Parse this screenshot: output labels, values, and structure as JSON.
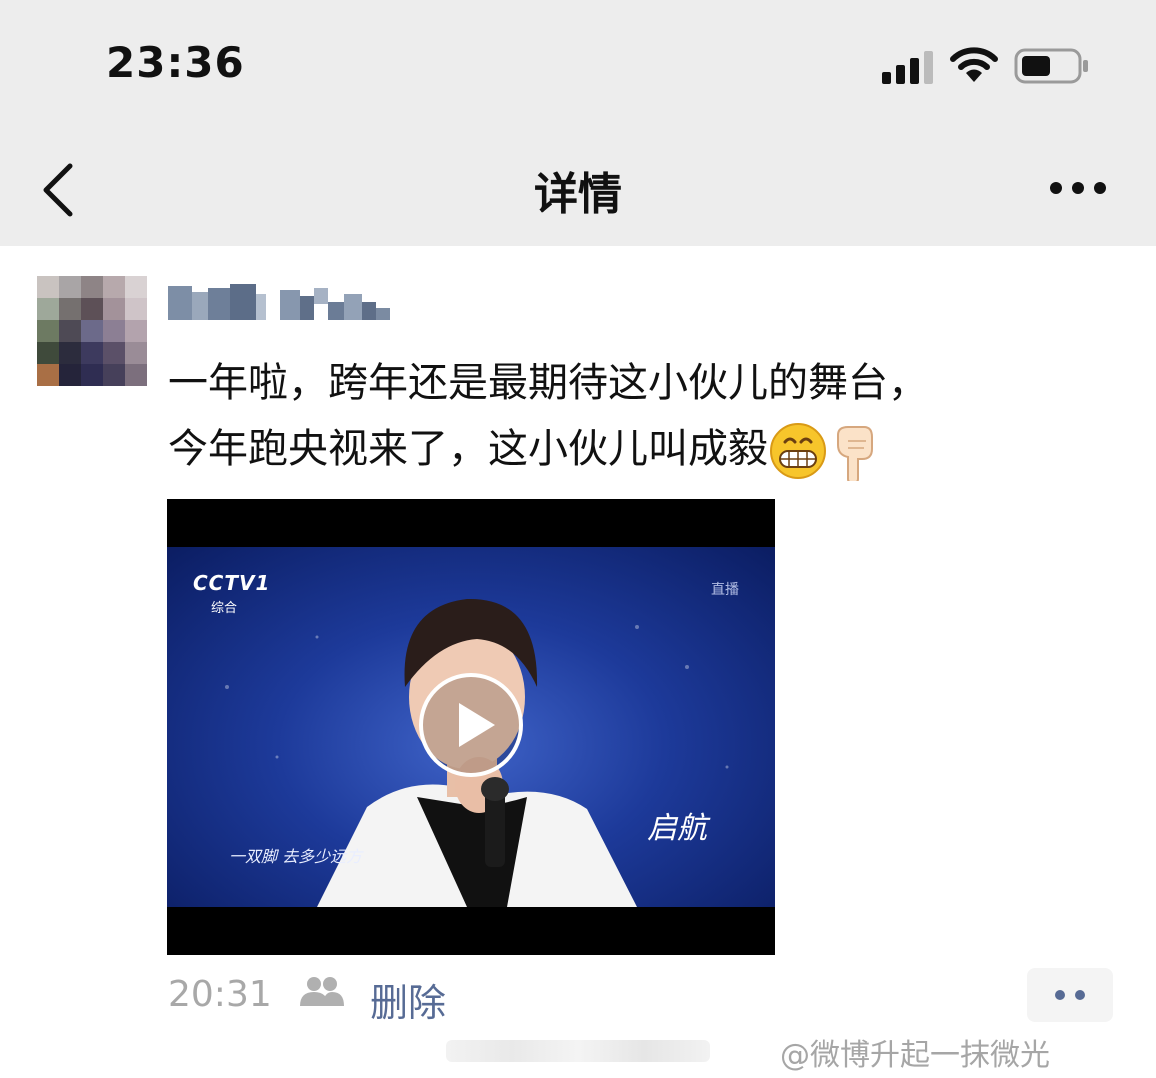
{
  "status_bar": {
    "time": "23:36",
    "icons": [
      "cellular-signal-icon",
      "wifi-icon",
      "battery-icon"
    ],
    "battery_level": 0.5
  },
  "nav": {
    "back_icon": "chevron-left-icon",
    "title": "详情",
    "more_icon": "ellipsis-icon"
  },
  "post": {
    "avatar": "pixelated-avatar",
    "username_pixelated": true,
    "text_line1": "一年啦，跨年还是最期待这小伙儿的舞台，",
    "text_line2": "今年跑央视来了，这小伙儿叫成毅",
    "emojis": [
      "grinning-face-emoji",
      "pointing-down-emoji"
    ],
    "video": {
      "channel_logo": "CCTV1",
      "channel_sub": "综合",
      "live_tag": "直播",
      "subtitle": "一双脚 去多少远方",
      "show_logo": "启航",
      "play_icon": "play-icon"
    },
    "footer": {
      "time": "20:31",
      "visibility_icon": "friends-group-icon",
      "delete_label": "删除",
      "comment_icon": "comment-dots-icon"
    }
  },
  "watermark": {
    "icon": "weibo-icon",
    "text": "@微博升起一抹微光"
  },
  "colors": {
    "header_bg": "#ededed",
    "link": "#576b95",
    "muted": "#a8a8a8",
    "video_blue": "#1d3a9a"
  }
}
